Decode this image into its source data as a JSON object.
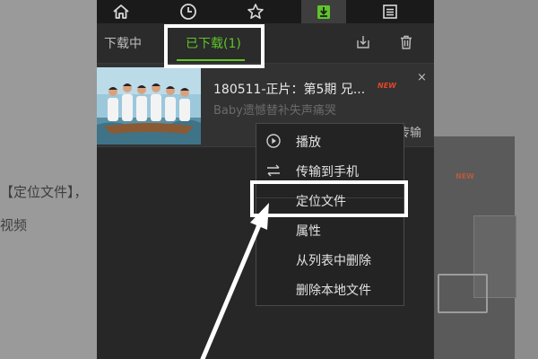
{
  "background": {
    "left_fragments": [
      "【定位文件】，",
      "视频"
    ],
    "right_badge": "NEW"
  },
  "nav": {
    "icons": [
      "home-icon",
      "clock-icon",
      "star-icon",
      "download-icon",
      "list-icon"
    ],
    "active": "download-icon",
    "accent": "#5ec42a"
  },
  "tabs": {
    "downloading": "下载中",
    "downloaded": "已下载(1)"
  },
  "item": {
    "title": "180511-正片：第5期 兄...",
    "subtitle": "Baby遗憾替补失声痛哭",
    "badge": "NEW",
    "close": "×",
    "transfer_peek": "传输"
  },
  "context_menu": {
    "items": [
      "播放",
      "传输到手机",
      "定位文件",
      "属性",
      "从列表中删除",
      "删除本地文件"
    ]
  }
}
